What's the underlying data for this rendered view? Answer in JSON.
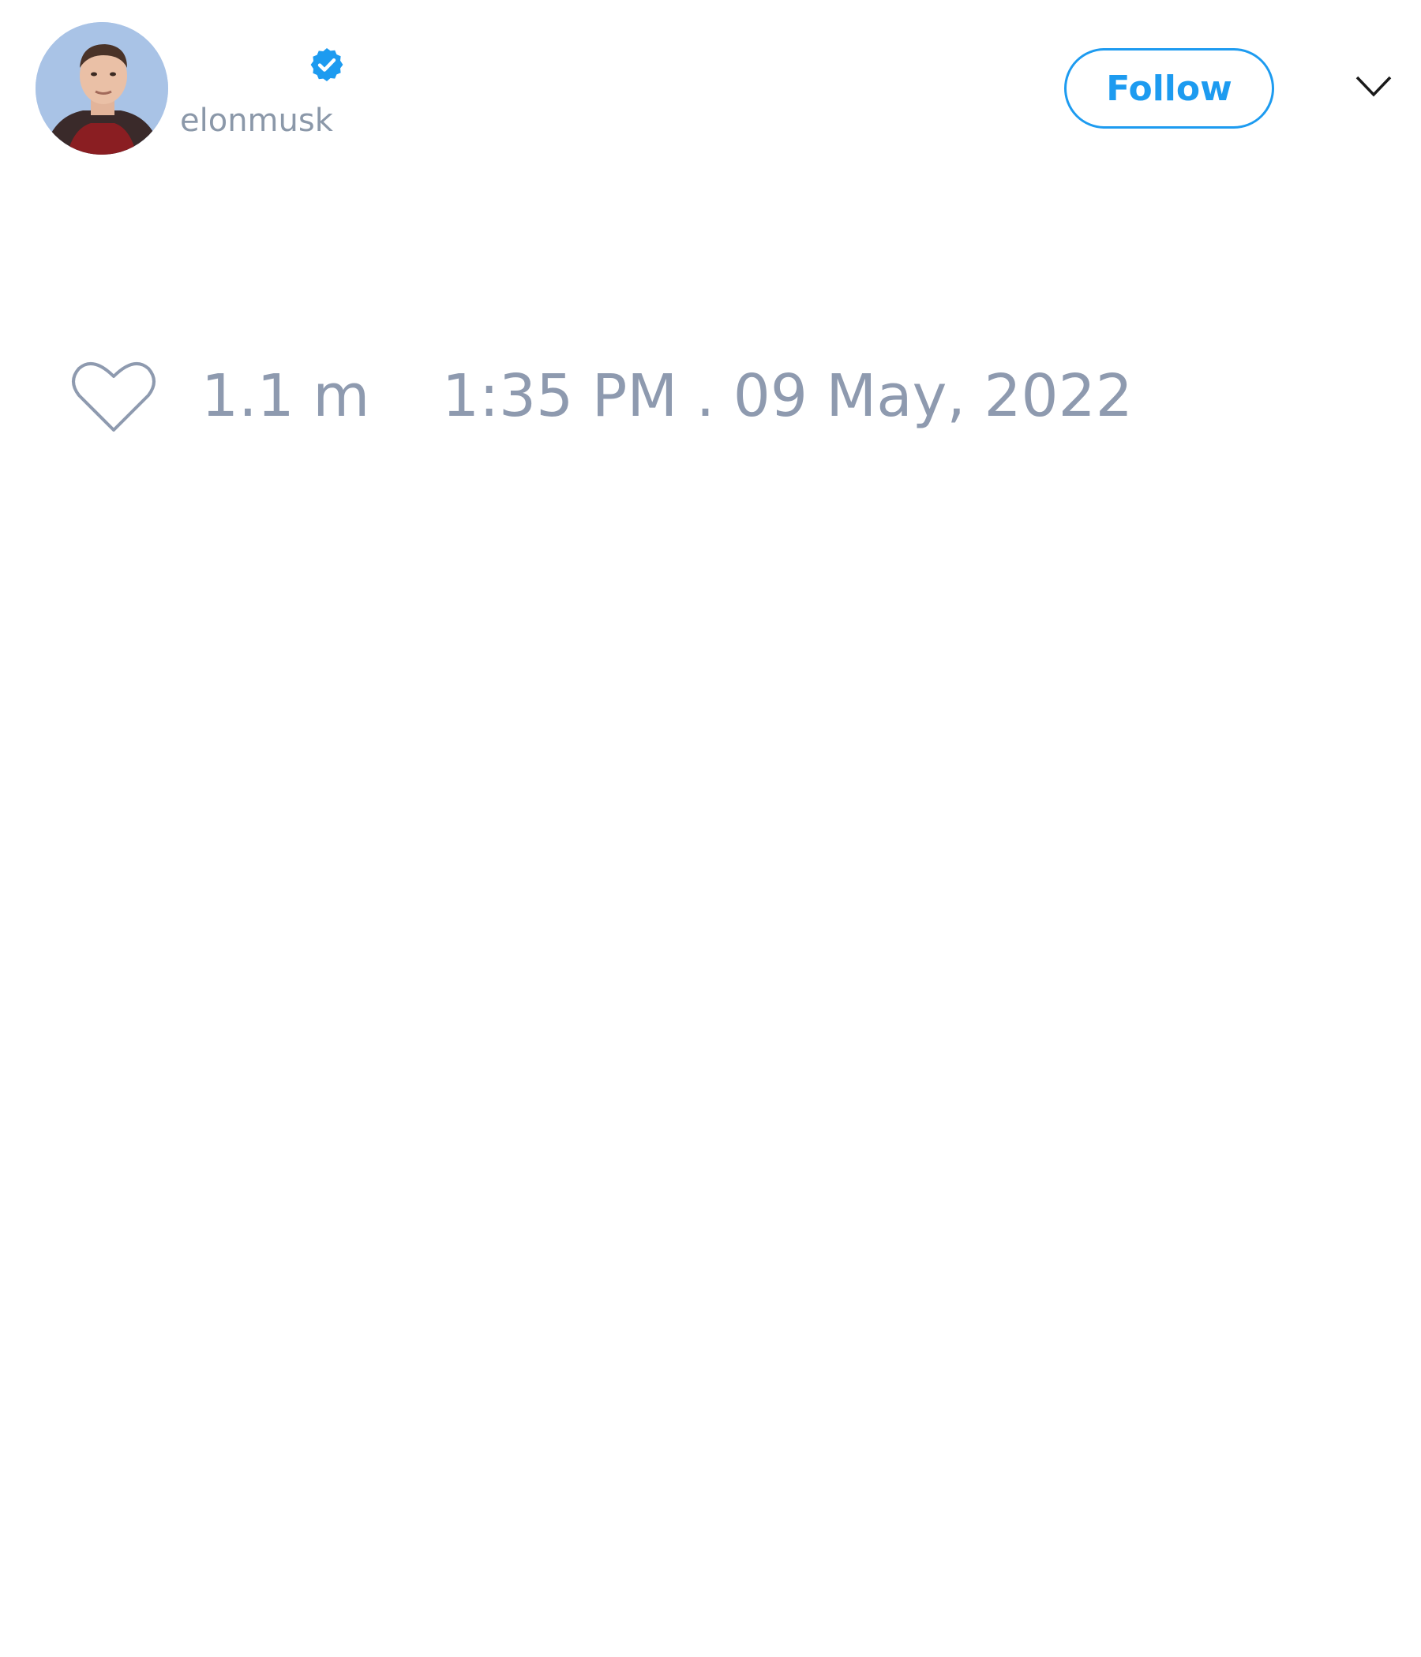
{
  "tweet": {
    "author": {
      "handle": "elonmusk",
      "avatar_icon": "profile-photo",
      "verified_icon": "verified-badge-icon"
    },
    "follow_label": "Follow",
    "menu_icon": "chevron-down-icon",
    "like_icon": "heart-icon",
    "like_count": "1.1 m",
    "timestamp": "1:35 PM . 09 May, 2022"
  },
  "colors": {
    "accent": "#1d9bf0",
    "muted_text": "#8e9aaf",
    "background": "#ffffff"
  }
}
